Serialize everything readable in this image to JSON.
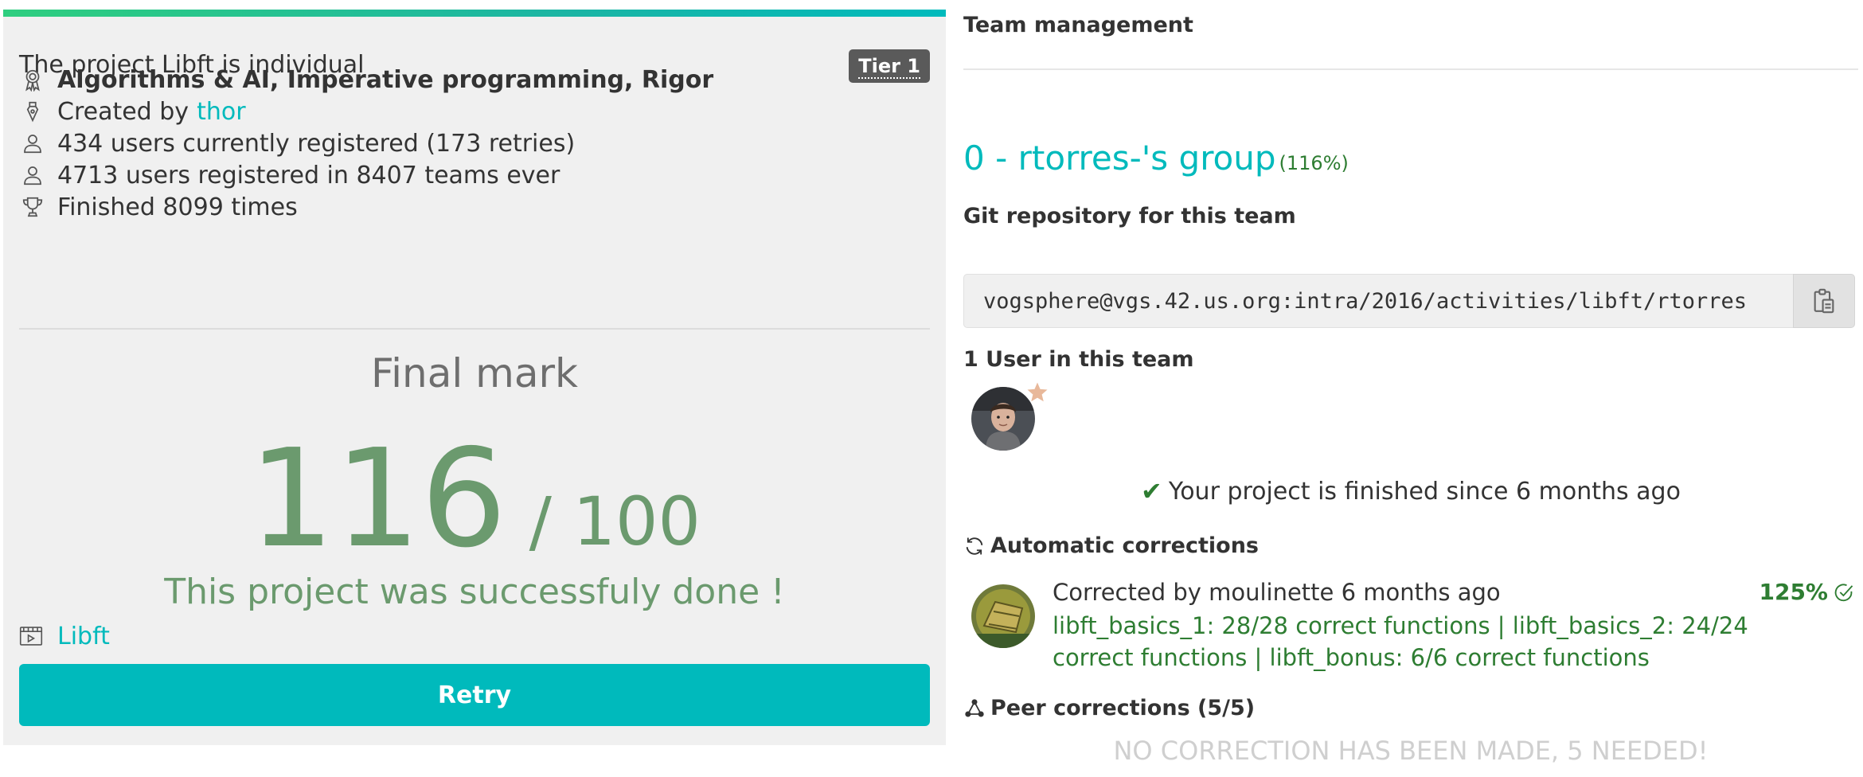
{
  "project": {
    "title": "The project Libft is individual",
    "tier": "Tier 1",
    "skills": "Algorithms & AI, Imperative programming, Rigor",
    "created_by_prefix": "Created by ",
    "creator": "thor",
    "registered": "434 users currently registered (173 retries)",
    "registered_ever": "4713 users registered in 8407 teams ever",
    "finished": "Finished 8099 times",
    "final_mark_label": "Final mark",
    "score": "116",
    "score_max": "/ 100",
    "success_message": "This project was successfuly done !",
    "link_label": "Libft",
    "retry_label": "Retry"
  },
  "team": {
    "section_title": "Team management",
    "group_name": "0 - rtorres-'s group",
    "group_pct": "(116%)",
    "git_title": "Git repository for this team",
    "git_url": "vogsphere@vgs.42.us.org:intra/2016/activities/libft/rtorres",
    "users_title": "1 User in this team",
    "finished_message": "Your project is finished since 6 months ago"
  },
  "corrections": {
    "auto_title": "Automatic corrections",
    "corrected_by": "Corrected by moulinette 6 months ago",
    "pct": "125%",
    "detail": "libft_basics_1: 28/28 correct functions | libft_basics_2: 24/24 correct functions | libft_bonus: 6/6 correct functions",
    "peer_title": "Peer corrections (5/5)",
    "no_correction": "NO CORRECTION HAS BEEN MADE, 5 NEEDED!"
  },
  "icons": {
    "skills": "badge-icon",
    "creator": "pen-icon",
    "users": "user-icon",
    "users_ever": "user-icon",
    "finished": "trophy-icon",
    "link": "video-icon",
    "copy": "clipboard-icon",
    "star": "star-icon",
    "check": "check-icon",
    "auto": "refresh-icon",
    "peer": "network-icon",
    "validated": "check-circle-icon"
  },
  "colors": {
    "accent": "#00babc",
    "success": "#6b9a6e",
    "success_dark": "#2e7d32",
    "tier_badge": "#5a5a5a",
    "star": "#e8b89a"
  }
}
